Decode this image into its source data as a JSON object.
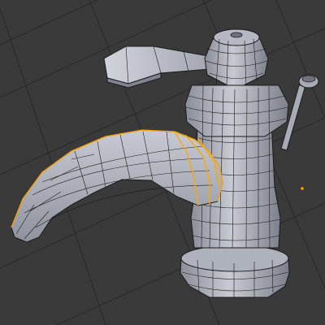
{
  "viewport": {
    "background": "#3a3a3a",
    "grid_color": "#2a2a2a",
    "selection_color": "#ffa500",
    "mesh_color": "#1b1b1b",
    "surface_color": "#b9bcc6"
  },
  "scene": {
    "object": "faucet-mesh",
    "selected_part": "spout-edge-loop",
    "origin_marker": "3d-cursor-dot"
  }
}
